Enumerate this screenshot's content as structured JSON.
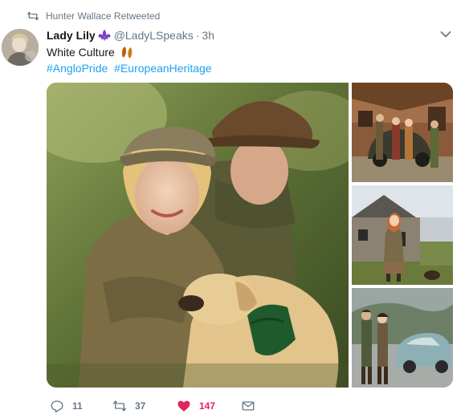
{
  "retweet_context": {
    "text": "Hunter Wallace Retweeted",
    "icon": "retweet-icon"
  },
  "author": {
    "display_name": "Lady Lily",
    "badge_icon": "fleur-de-lis-icon",
    "handle": "@LadyLSpeaks",
    "separator": "·",
    "time": "3h"
  },
  "tweet": {
    "text": "White Culture",
    "emoji_icon": "autumn-leaves-emoji",
    "hashtags": [
      "#AngloPride",
      "#EuropeanHeritage"
    ]
  },
  "media": {
    "photos": [
      {
        "icon": "photo-couple-with-labrador"
      },
      {
        "icon": "photo-group-with-vintage-car"
      },
      {
        "icon": "photo-woman-stone-cottage"
      },
      {
        "icon": "photo-couple-with-classic-car"
      }
    ]
  },
  "actions": {
    "reply_count": "11",
    "retweet_count": "37",
    "like_count": "147"
  },
  "colors": {
    "accent": "#1da1f2",
    "like": "#e0245e",
    "secondary_text": "#657786",
    "fleur_badge": "#7d3cc8"
  }
}
